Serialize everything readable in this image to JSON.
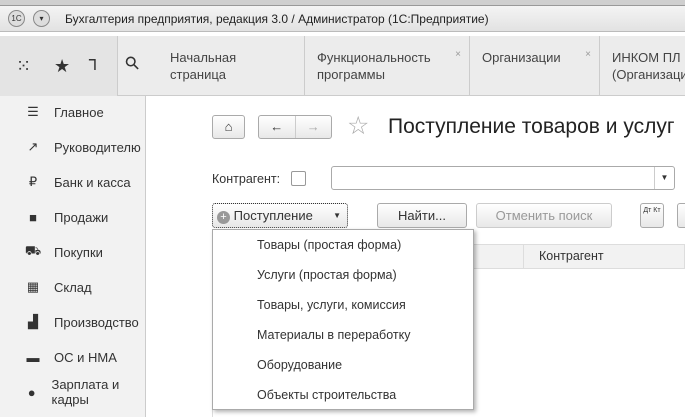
{
  "window": {
    "title": "Бухгалтерия предприятия, редакция 3.0 / Администратор  (1С:Предприятие)",
    "logo": "1С"
  },
  "tabs": [
    {
      "label": "Начальная страница",
      "closable": false
    },
    {
      "label": "Функциональность программы",
      "closable": true
    },
    {
      "label": "Организации",
      "closable": true
    },
    {
      "label": "ИНКОМ ПЛ (Организаци",
      "closable": false
    }
  ],
  "sidebar": {
    "items": [
      {
        "label": "Главное",
        "icon": "menu-icon"
      },
      {
        "label": "Руководителю",
        "icon": "trend-icon"
      },
      {
        "label": "Банк и касса",
        "icon": "ruble-icon"
      },
      {
        "label": "Продажи",
        "icon": "bag-icon"
      },
      {
        "label": "Покупки",
        "icon": "cart-icon"
      },
      {
        "label": "Склад",
        "icon": "grid-icon"
      },
      {
        "label": "Производство",
        "icon": "factory-icon"
      },
      {
        "label": "ОС и НМА",
        "icon": "truck-icon"
      },
      {
        "label": "Зарплата и кадры",
        "icon": "person-icon"
      }
    ]
  },
  "page": {
    "title": "Поступление товаров и услуг",
    "counterparty_label": "Контрагент:",
    "counterparty_value": "",
    "create_button": "Поступление",
    "find_button": "Найти...",
    "cancel_search_button": "Отменить поиск",
    "dtkt_button": "Дт Кт",
    "column_counterparty": "Контрагент"
  },
  "menu": {
    "items": [
      "Товары (простая форма)",
      "Услуги (простая форма)",
      "Товары, услуги, комиссия",
      "Материалы в переработку",
      "Оборудование",
      "Объекты строительства"
    ]
  }
}
